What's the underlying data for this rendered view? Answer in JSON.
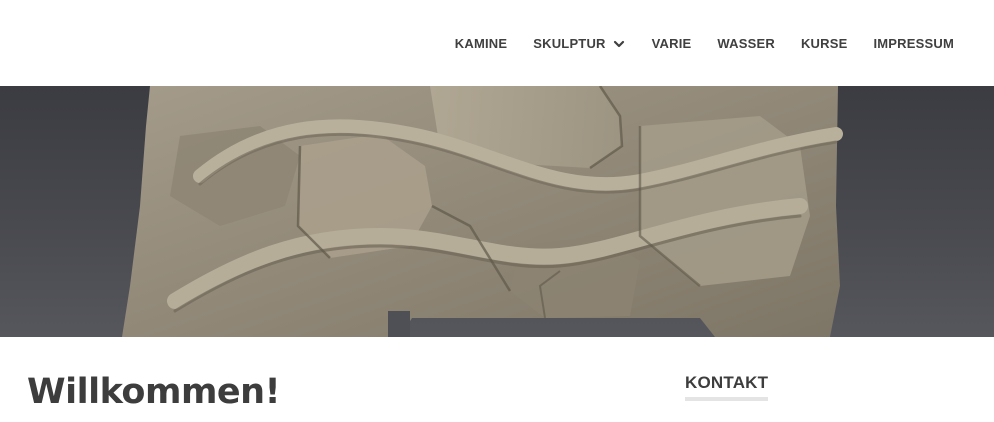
{
  "nav": {
    "items": [
      {
        "label": "KAMINE",
        "has_dropdown": false
      },
      {
        "label": "SKULPTUR",
        "has_dropdown": true
      },
      {
        "label": "VARIE",
        "has_dropdown": false
      },
      {
        "label": "WASSER",
        "has_dropdown": false
      },
      {
        "label": "KURSE",
        "has_dropdown": false
      },
      {
        "label": "IMPRESSUM",
        "has_dropdown": false
      }
    ]
  },
  "hero": {
    "image": "stone-relief-sculpture"
  },
  "main": {
    "title": "Willkommen!"
  },
  "sidebar": {
    "widget_title": "KONTAKT"
  },
  "colors": {
    "text": "#3d3d3d",
    "nav_text": "#404040",
    "hero_background": "#45464c",
    "stone": "#9c9383",
    "widget_underline": "#e4e4e4"
  }
}
